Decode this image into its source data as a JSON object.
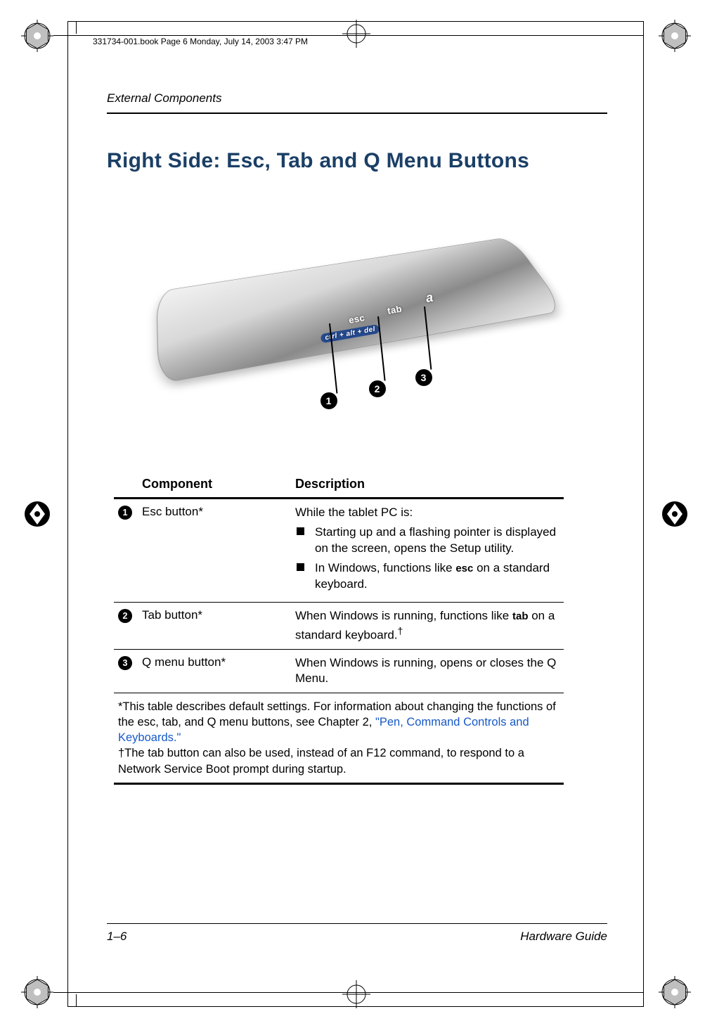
{
  "book_stamp": "331734-001.book  Page 6  Monday, July 14, 2003  3:47 PM",
  "running_head": "External Components",
  "section_title": "Right Side: Esc, Tab and Q Menu Buttons",
  "figure": {
    "label_ctrl": "ctrl + alt + del",
    "label_esc": "esc",
    "label_tab": "tab",
    "label_a": "a",
    "callouts": {
      "c1": "1",
      "c2": "2",
      "c3": "3"
    }
  },
  "table": {
    "head_component": "Component",
    "head_description": "Description",
    "rows": [
      {
        "num": "1",
        "component": "Esc button*",
        "desc_intro": "While the tablet PC is:",
        "bullets": [
          "Starting up and a flashing pointer is displayed on the screen, opens the Setup utility.",
          {
            "pre": "In Windows, functions like ",
            "bold": "esc",
            "post": " on a standard keyboard."
          }
        ]
      },
      {
        "num": "2",
        "component": "Tab button*",
        "desc": {
          "pre": "When Windows is running, functions like ",
          "bold": "tab",
          "post": " on a standard keyboard.",
          "dagger": "†"
        }
      },
      {
        "num": "3",
        "component": "Q menu button*",
        "desc_plain": "When Windows is running, opens or closes the Q Menu."
      }
    ],
    "footnote_star_pre": "*This table describes default settings. For information about changing the functions of the esc, tab, and Q menu buttons, see Chapter 2, ",
    "footnote_star_link": "\"Pen, Command Controls and Keyboards.\"",
    "footnote_dagger": "†The tab button can also be used, instead of an F12 command, to respond to a Network Service Boot prompt during startup."
  },
  "footer": {
    "left": "1–6",
    "right": "Hardware Guide"
  }
}
